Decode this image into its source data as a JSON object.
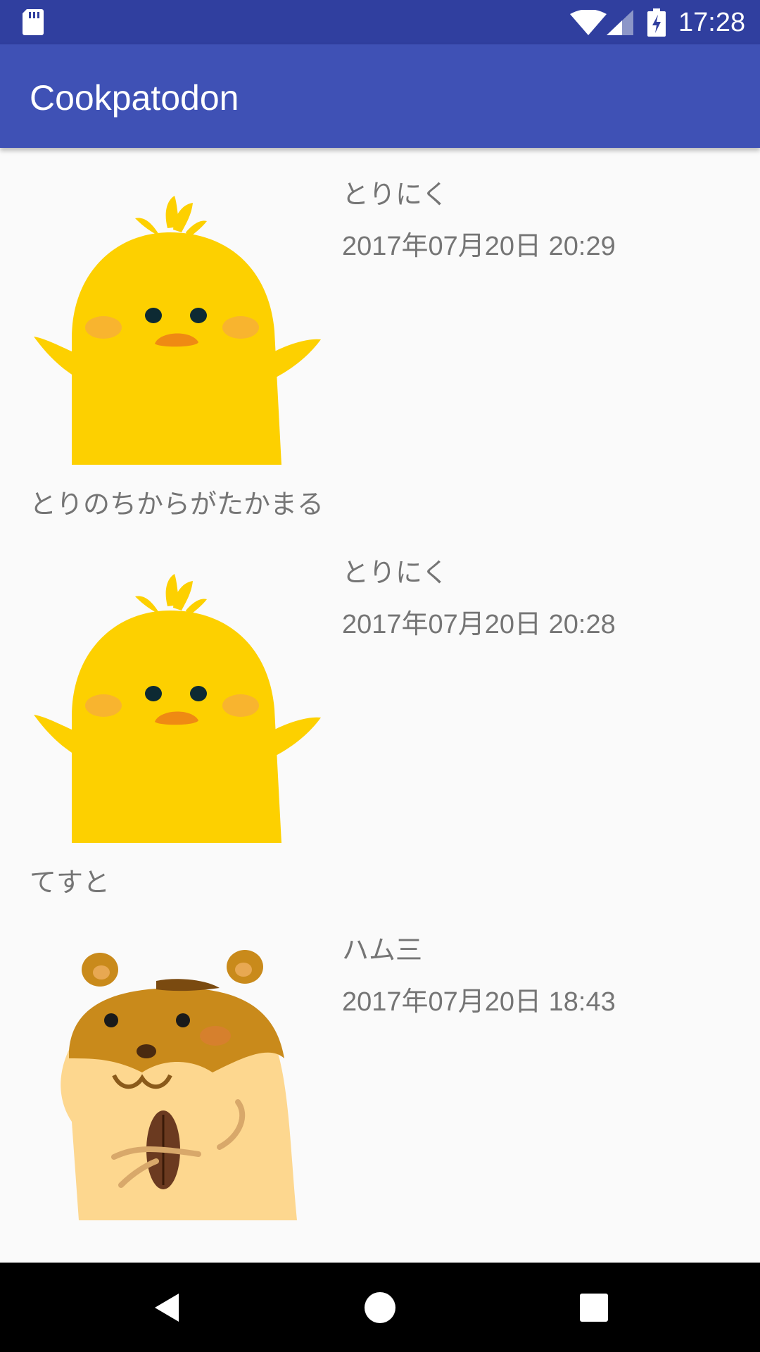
{
  "status_bar": {
    "time": "17:28",
    "icons": [
      "sd-card-icon",
      "wifi-icon",
      "cell-signal-icon",
      "battery-charging-icon"
    ]
  },
  "app_bar": {
    "title": "Cookpatodon"
  },
  "posts": [
    {
      "username": "とりにく",
      "timestamp": "2017年07月20日 20:29",
      "content": "とりのちからがたかまる",
      "avatar": "chick-avatar"
    },
    {
      "username": "とりにく",
      "timestamp": "2017年07月20日 20:28",
      "content": "てすと",
      "avatar": "chick-avatar"
    },
    {
      "username": "ハム三",
      "timestamp": "2017年07月20日 18:43",
      "content": "",
      "avatar": "hamster-avatar"
    }
  ],
  "nav_bar": {
    "buttons": [
      "back-icon",
      "home-icon",
      "recents-icon"
    ]
  },
  "colors": {
    "status_bar": "#303f9f",
    "app_bar": "#3f51b5",
    "background": "#fafafa",
    "text_secondary": "#757575",
    "chick_yellow": "#fdd000"
  }
}
